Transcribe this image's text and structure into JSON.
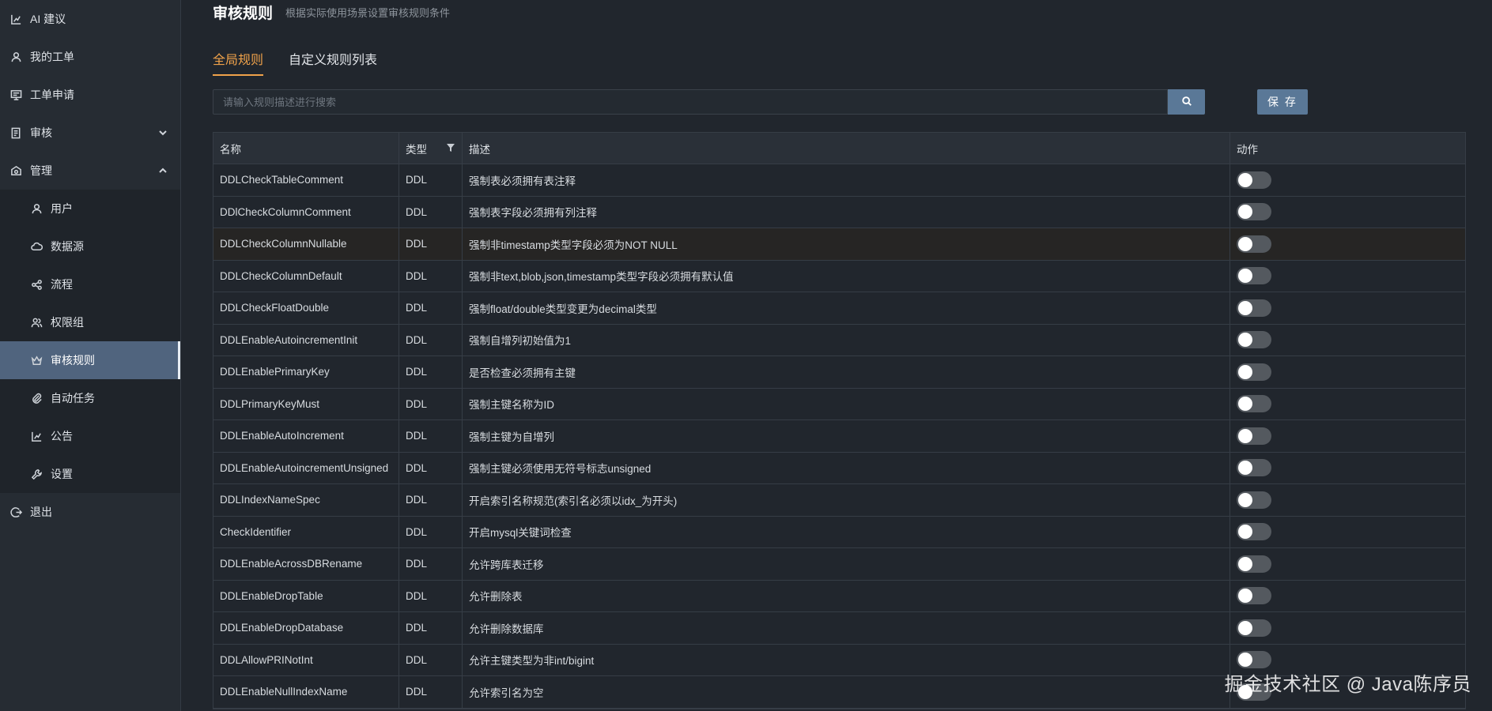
{
  "sidebar": {
    "items": [
      {
        "label": "AI 建议"
      },
      {
        "label": "我的工单"
      },
      {
        "label": "工单申请"
      },
      {
        "label": "审核"
      },
      {
        "label": "管理"
      }
    ],
    "sub_items": [
      {
        "label": "用户"
      },
      {
        "label": "数据源"
      },
      {
        "label": "流程"
      },
      {
        "label": "权限组"
      },
      {
        "label": "审核规则"
      },
      {
        "label": "自动任务"
      },
      {
        "label": "公告"
      },
      {
        "label": "设置"
      }
    ],
    "logout": "退出"
  },
  "header": {
    "title": "审核规则",
    "subtitle": "根据实际使用场景设置审核规则条件"
  },
  "tabs": [
    {
      "label": "全局规则",
      "active": true
    },
    {
      "label": "自定义规则列表",
      "active": false
    }
  ],
  "search": {
    "placeholder": "请输入规则描述进行搜索",
    "value": ""
  },
  "toolbar": {
    "save_label": "保 存"
  },
  "table": {
    "columns": [
      "名称",
      "类型",
      "描述",
      "动作"
    ],
    "rows": [
      {
        "name": "DDLCheckTableComment",
        "type": "DDL",
        "desc": "强制表必须拥有表注释",
        "enabled": false
      },
      {
        "name": "DDlCheckColumnComment",
        "type": "DDL",
        "desc": "强制表字段必须拥有列注释",
        "enabled": false
      },
      {
        "name": "DDLCheckColumnNullable",
        "type": "DDL",
        "desc": "强制非timestamp类型字段必须为NOT NULL",
        "enabled": false
      },
      {
        "name": "DDLCheckColumnDefault",
        "type": "DDL",
        "desc": "强制非text,blob,json,timestamp类型字段必须拥有默认值",
        "enabled": false
      },
      {
        "name": "DDLCheckFloatDouble",
        "type": "DDL",
        "desc": "强制float/double类型变更为decimal类型",
        "enabled": false
      },
      {
        "name": "DDLEnableAutoincrementInit",
        "type": "DDL",
        "desc": "强制自增列初始值为1",
        "enabled": false
      },
      {
        "name": "DDLEnablePrimaryKey",
        "type": "DDL",
        "desc": "是否检查必须拥有主键",
        "enabled": false
      },
      {
        "name": "DDLPrimaryKeyMust",
        "type": "DDL",
        "desc": "强制主键名称为ID",
        "enabled": false
      },
      {
        "name": "DDLEnableAutoIncrement",
        "type": "DDL",
        "desc": "强制主键为自增列",
        "enabled": false
      },
      {
        "name": "DDLEnableAutoincrementUnsigned",
        "type": "DDL",
        "desc": "强制主键必须使用无符号标志unsigned",
        "enabled": false
      },
      {
        "name": "DDLIndexNameSpec",
        "type": "DDL",
        "desc": "开启索引名称规范(索引名必须以idx_为开头)",
        "enabled": false
      },
      {
        "name": "CheckIdentifier",
        "type": "DDL",
        "desc": "开启mysql关键词检查",
        "enabled": false
      },
      {
        "name": "DDLEnableAcrossDBRename",
        "type": "DDL",
        "desc": "允许跨库表迁移",
        "enabled": false
      },
      {
        "name": "DDLEnableDropTable",
        "type": "DDL",
        "desc": "允许删除表",
        "enabled": false
      },
      {
        "name": "DDLEnableDropDatabase",
        "type": "DDL",
        "desc": "允许删除数据库",
        "enabled": false
      },
      {
        "name": "DDLAllowPRINotInt",
        "type": "DDL",
        "desc": "允许主键类型为非int/bigint",
        "enabled": false
      },
      {
        "name": "DDLEnableNullIndexName",
        "type": "DDL",
        "desc": "允许索引名为空",
        "enabled": false
      }
    ]
  },
  "watermark": "掘金技术社区 @ Java陈序员"
}
